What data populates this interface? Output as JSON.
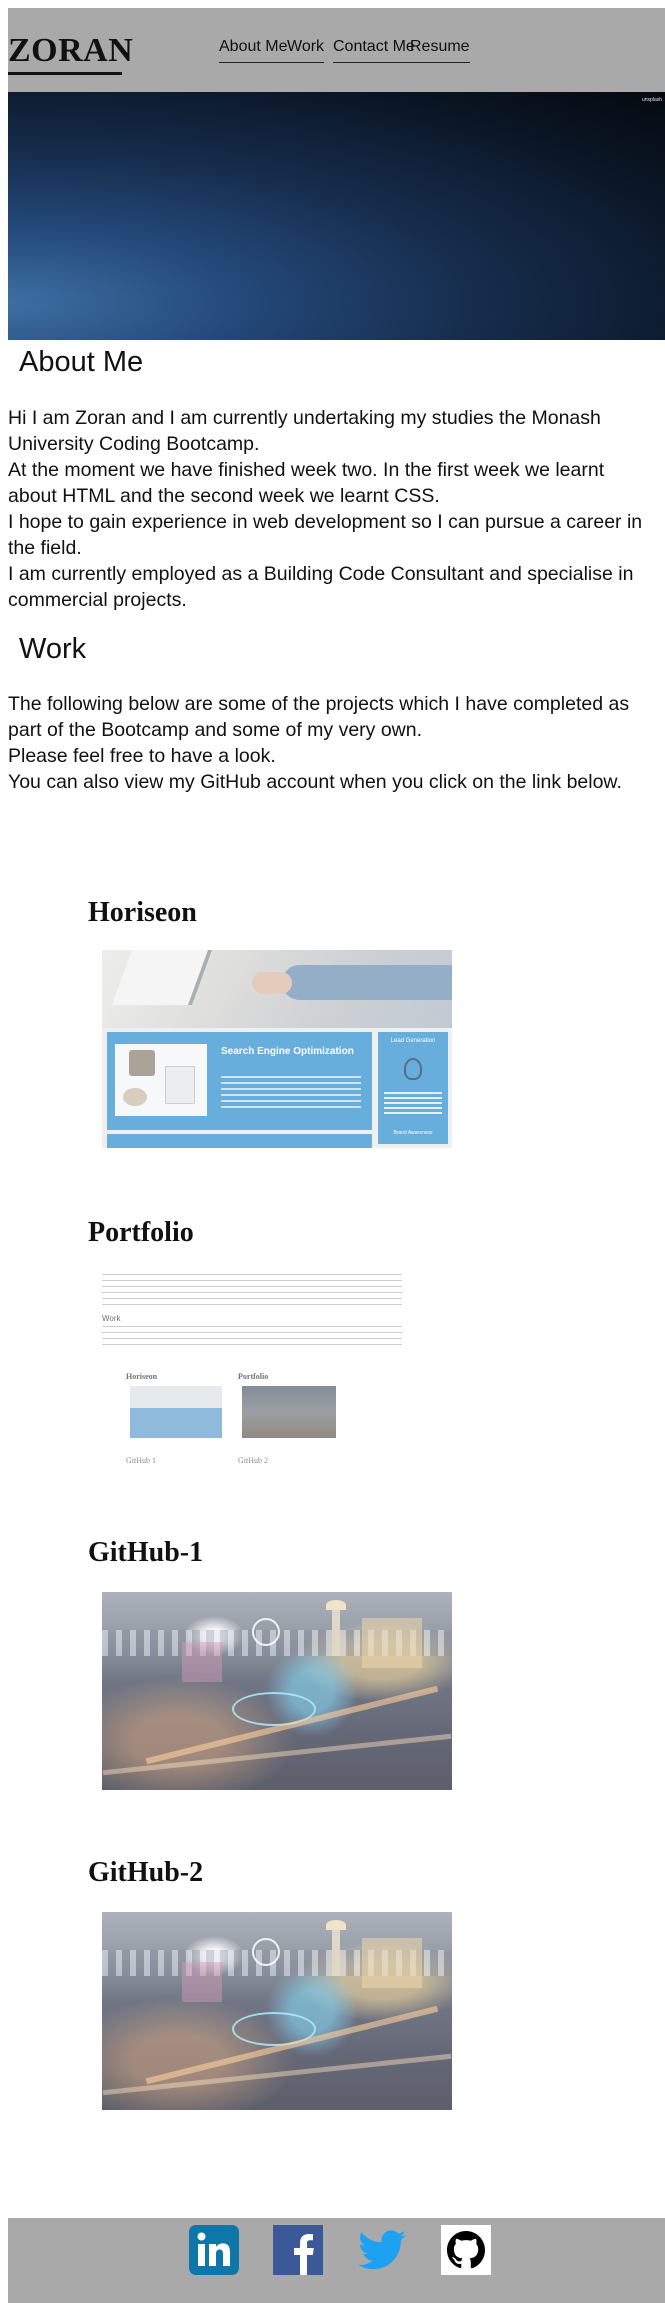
{
  "header": {
    "brand": "ZORAN",
    "nav": [
      {
        "label": "About Me"
      },
      {
        "label": "Work"
      },
      {
        "label": "Contact Me"
      },
      {
        "label": "Resume"
      }
    ]
  },
  "hero": {
    "tag": "unsplash"
  },
  "about": {
    "title": "About Me",
    "paragraph": "Hi I am Zoran and I am currently undertaking my studies the Monash University Coding Bootcamp.\nAt the moment we have finished week two. In the first week we learnt about HTML and the second week we learnt CSS.\nI hope to gain experience in web development so I can pursue a career in the field.\nI am currently employed as a Building Code Consultant and specialise in commercial projects."
  },
  "work": {
    "title": "Work",
    "paragraph": "The following below are some of the projects which I have completed as part of the Bootcamp and some of my very own.\nPlease feel free to have a look.\nYou can also view my GitHub account when you click on the link below."
  },
  "projects": [
    {
      "title": "Horiseon",
      "thumb": {
        "heading": "Search Engine Optimization",
        "side_title": "Lead Generation",
        "side_footer": "Brand Awareness"
      }
    },
    {
      "title": "Portfolio",
      "thumb": {
        "work": "Work",
        "labels": [
          "Horiseon",
          "Portfolio",
          "GitHub 1",
          "GitHub 2"
        ]
      }
    },
    {
      "title": "GitHub-1"
    },
    {
      "title": "GitHub-2"
    }
  ],
  "footer": {
    "social": [
      {
        "name": "LinkedIn",
        "icon": "linkedin-icon",
        "color": "#0077b5"
      },
      {
        "name": "Facebook",
        "icon": "facebook-icon",
        "color": "#3b5998"
      },
      {
        "name": "Twitter",
        "icon": "twitter-icon",
        "color": "#1da1f2"
      },
      {
        "name": "GitHub",
        "icon": "github-icon",
        "color": "#000000"
      }
    ]
  }
}
